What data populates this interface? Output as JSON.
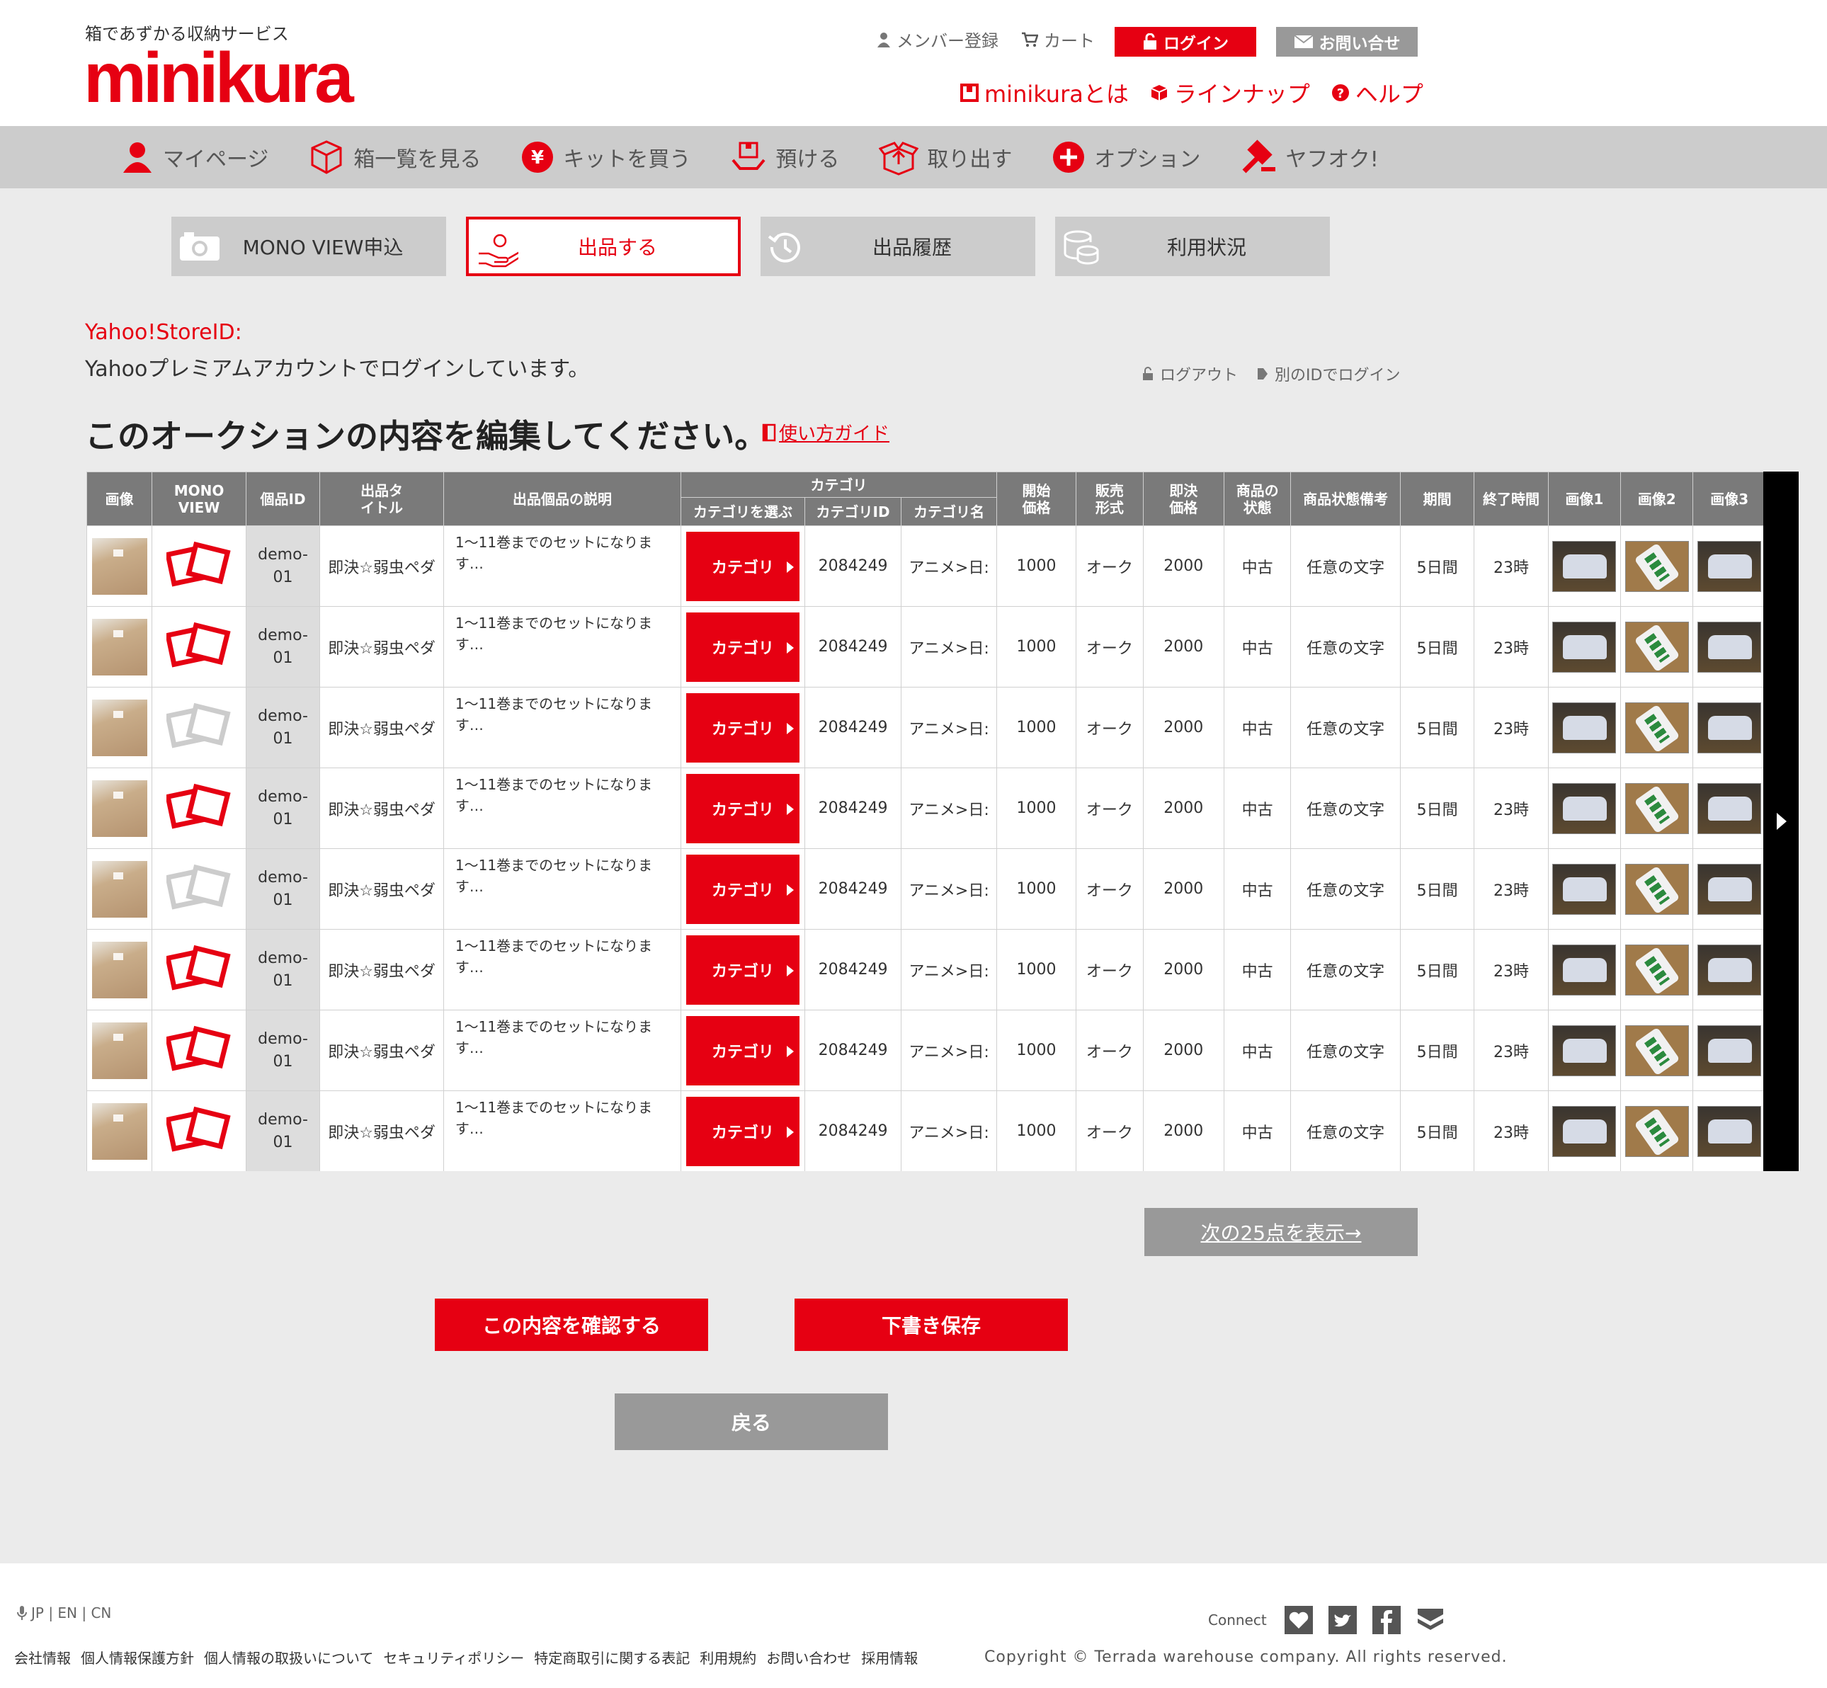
{
  "header": {
    "tagline": "箱であずかる収納サービス",
    "logo": "minikura",
    "member_register": "メンバー登録",
    "cart": "カート",
    "login": "ログイン",
    "contact": "お問い合せ",
    "about": "minikuraとは",
    "lineup": "ラインナップ",
    "help": "ヘルプ"
  },
  "global_nav": [
    {
      "label": "マイページ",
      "icon": "person-icon"
    },
    {
      "label": "箱一覧を見る",
      "icon": "box-icon"
    },
    {
      "label": "キットを買う",
      "icon": "yen-icon"
    },
    {
      "label": "預ける",
      "icon": "hands-box-icon"
    },
    {
      "label": "取り出す",
      "icon": "open-box-icon"
    },
    {
      "label": "オプション",
      "icon": "plus-icon"
    },
    {
      "label": "ヤフオク!",
      "icon": "gavel-icon"
    }
  ],
  "sub_tabs": [
    {
      "label": "MONO VIEW申込",
      "icon": "camera-icon",
      "active": false
    },
    {
      "label": "出品する",
      "icon": "hand-coin-icon",
      "active": true
    },
    {
      "label": "出品履歴",
      "icon": "history-icon",
      "active": false
    },
    {
      "label": "利用状況",
      "icon": "coins-icon",
      "active": false
    }
  ],
  "store": {
    "id_label": "Yahoo!StoreID:",
    "message": "Yahooプレミアムアカウントでログインしています。",
    "logout": "ログアウト",
    "other_login": "別のIDでログイン"
  },
  "page_title": "このオークションの内容を編集してください。",
  "guide_link": "使い方ガイド",
  "table": {
    "headers": {
      "image": "画像",
      "monoview": "MONO VIEW",
      "item_id": "個品ID",
      "title": "出品タイトル",
      "desc": "出品個品の説明",
      "category": "カテゴリ",
      "cat_select": "カテゴリを選ぶ",
      "cat_id": "カテゴリID",
      "cat_name": "カテゴリ名",
      "start_price": "開始価格",
      "sale_type": "販売形式",
      "buy_price": "即決価格",
      "condition": "商品の状態",
      "condition_note": "商品状態備考",
      "period": "期間",
      "end_time": "終了時間",
      "img1": "画像1",
      "img2": "画像2",
      "img3": "画像3"
    },
    "rows": [
      {
        "monoview_active": true,
        "item_id": "demo-01",
        "title": "即決☆弱虫ペダ",
        "desc": "1〜11巻までのセットになります…",
        "cat_btn": "カテゴリ",
        "cat_id": "2084249",
        "cat_name": "アニメ>日:",
        "start_price": "1000",
        "sale_type": "オーク",
        "buy_price": "2000",
        "condition": "中古",
        "condition_note": "任意の文字",
        "period": "5日間",
        "end_time": "23時"
      },
      {
        "monoview_active": true,
        "item_id": "demo-01",
        "title": "即決☆弱虫ペダ",
        "desc": "1〜11巻までのセットになります…",
        "cat_btn": "カテゴリ",
        "cat_id": "2084249",
        "cat_name": "アニメ>日:",
        "start_price": "1000",
        "sale_type": "オーク",
        "buy_price": "2000",
        "condition": "中古",
        "condition_note": "任意の文字",
        "period": "5日間",
        "end_time": "23時"
      },
      {
        "monoview_active": false,
        "item_id": "demo-01",
        "title": "即決☆弱虫ペダ",
        "desc": "1〜11巻までのセットになります…",
        "cat_btn": "カテゴリ",
        "cat_id": "2084249",
        "cat_name": "アニメ>日:",
        "start_price": "1000",
        "sale_type": "オーク",
        "buy_price": "2000",
        "condition": "中古",
        "condition_note": "任意の文字",
        "period": "5日間",
        "end_time": "23時"
      },
      {
        "monoview_active": true,
        "item_id": "demo-01",
        "title": "即決☆弱虫ペダ",
        "desc": "1〜11巻までのセットになります…",
        "cat_btn": "カテゴリ",
        "cat_id": "2084249",
        "cat_name": "アニメ>日:",
        "start_price": "1000",
        "sale_type": "オーク",
        "buy_price": "2000",
        "condition": "中古",
        "condition_note": "任意の文字",
        "period": "5日間",
        "end_time": "23時"
      },
      {
        "monoview_active": false,
        "item_id": "demo-01",
        "title": "即決☆弱虫ペダ",
        "desc": "1〜11巻までのセットになります…",
        "cat_btn": "カテゴリ",
        "cat_id": "2084249",
        "cat_name": "アニメ>日:",
        "start_price": "1000",
        "sale_type": "オーク",
        "buy_price": "2000",
        "condition": "中古",
        "condition_note": "任意の文字",
        "period": "5日間",
        "end_time": "23時"
      },
      {
        "monoview_active": true,
        "item_id": "demo-01",
        "title": "即決☆弱虫ペダ",
        "desc": "1〜11巻までのセットになります…",
        "cat_btn": "カテゴリ",
        "cat_id": "2084249",
        "cat_name": "アニメ>日:",
        "start_price": "1000",
        "sale_type": "オーク",
        "buy_price": "2000",
        "condition": "中古",
        "condition_note": "任意の文字",
        "period": "5日間",
        "end_time": "23時"
      },
      {
        "monoview_active": true,
        "item_id": "demo-01",
        "title": "即決☆弱虫ペダ",
        "desc": "1〜11巻までのセットになります…",
        "cat_btn": "カテゴリ",
        "cat_id": "2084249",
        "cat_name": "アニメ>日:",
        "start_price": "1000",
        "sale_type": "オーク",
        "buy_price": "2000",
        "condition": "中古",
        "condition_note": "任意の文字",
        "period": "5日間",
        "end_time": "23時"
      },
      {
        "monoview_active": true,
        "item_id": "demo-01",
        "title": "即決☆弱虫ペダ",
        "desc": "1〜11巻までのセットになります…",
        "cat_btn": "カテゴリ",
        "cat_id": "2084249",
        "cat_name": "アニメ>日:",
        "start_price": "1000",
        "sale_type": "オーク",
        "buy_price": "2000",
        "condition": "中古",
        "condition_note": "任意の文字",
        "period": "5日間",
        "end_time": "23時"
      }
    ]
  },
  "buttons": {
    "next": "次の25点を表示→",
    "confirm": "この内容を確認する",
    "draft": "下書き保存",
    "back": "戻る"
  },
  "footer": {
    "lang": "JP | EN | CN",
    "links": [
      "会社情報",
      "個人情報保護方針",
      "個人情報の取扱いについて",
      "セキュリティポリシー",
      "特定商取引に関する表記",
      "利用規約",
      "お問い合わせ",
      "採用情報"
    ],
    "connect": "Connect",
    "copyright": "Copyright © Terrada warehouse company. All rights reserved."
  },
  "colors": {
    "brand": "#e60012",
    "gray_button": "#999999",
    "nav_bg": "#cccccc",
    "table_header": "#7a7a7a"
  }
}
